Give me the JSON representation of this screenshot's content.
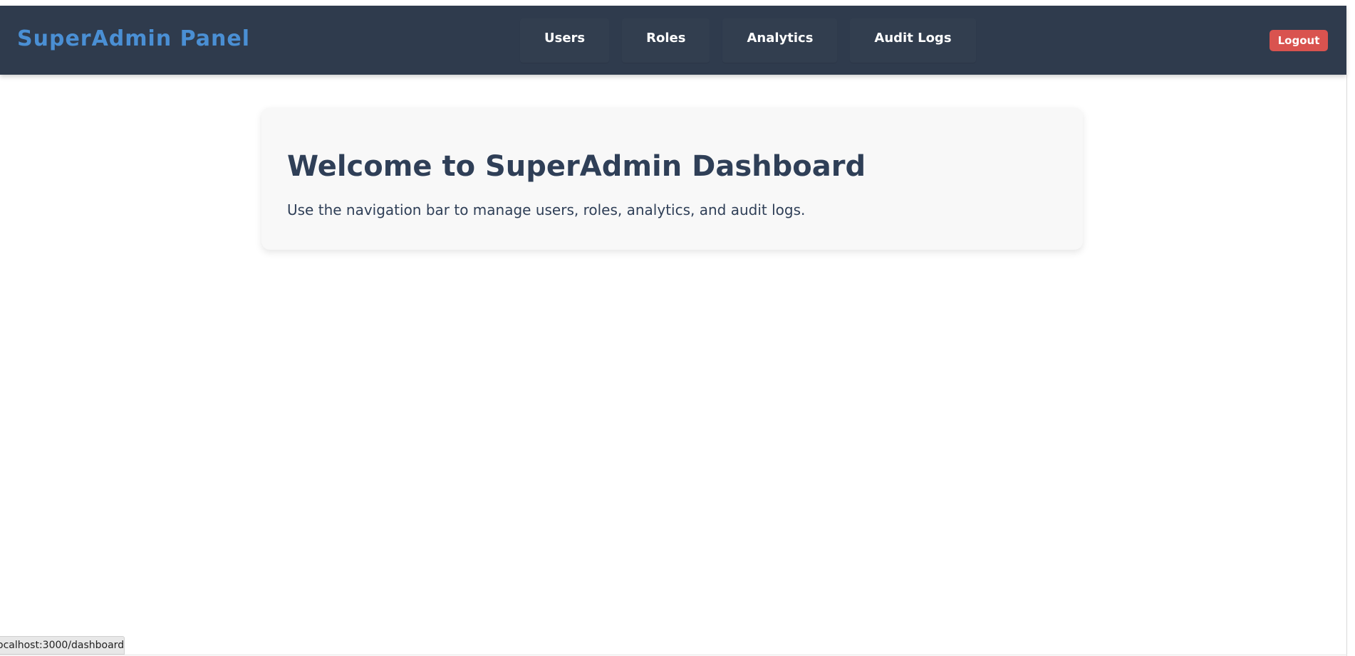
{
  "app": {
    "brand": "SuperAdmin Panel"
  },
  "nav": {
    "items": [
      {
        "label": "Users"
      },
      {
        "label": "Roles"
      },
      {
        "label": "Analytics"
      },
      {
        "label": "Audit Logs"
      }
    ],
    "logout_label": "Logout"
  },
  "main": {
    "title": "Welcome to SuperAdmin Dashboard",
    "description": "Use the navigation bar to manage users, roles, analytics, and audit logs."
  },
  "status": {
    "url": "ocalhost:3000/dashboard"
  },
  "colors": {
    "navbar_bg": "#2f3b4d",
    "brand": "#4a8fd4",
    "logout_bg": "#d9534f",
    "card_bg": "#f8f8f8",
    "heading": "#2f3f57"
  }
}
